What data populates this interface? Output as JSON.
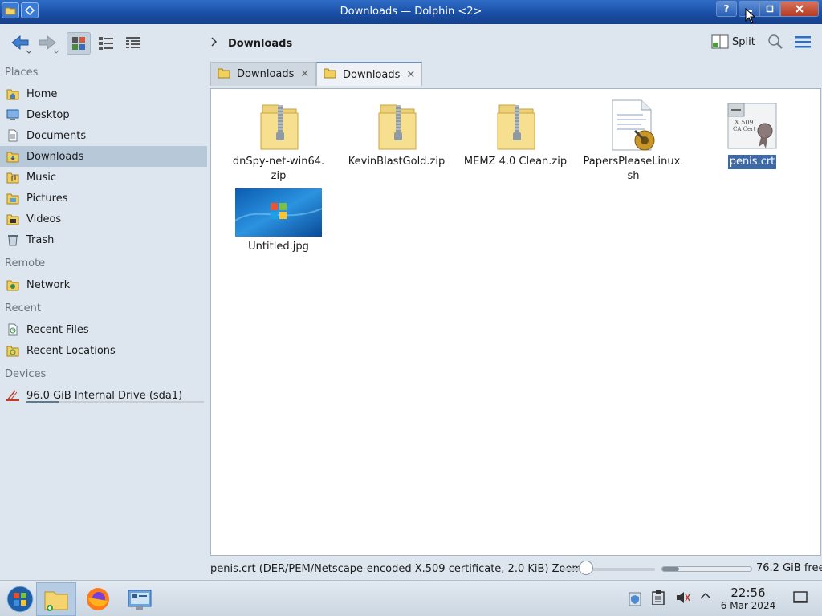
{
  "window": {
    "title": "Downloads — Dolphin <2>",
    "buttons": {
      "help": "?"
    }
  },
  "toolbar": {
    "breadcrumb": "Downloads",
    "split_label": "Split"
  },
  "sidebar": {
    "places_title": "Places",
    "places": [
      {
        "label": "Home",
        "icon": "home-folder-icon"
      },
      {
        "label": "Desktop",
        "icon": "desktop-icon"
      },
      {
        "label": "Documents",
        "icon": "documents-icon"
      },
      {
        "label": "Downloads",
        "icon": "downloads-folder-icon",
        "active": true
      },
      {
        "label": "Music",
        "icon": "music-folder-icon"
      },
      {
        "label": "Pictures",
        "icon": "pictures-folder-icon"
      },
      {
        "label": "Videos",
        "icon": "videos-folder-icon"
      },
      {
        "label": "Trash",
        "icon": "trash-icon"
      }
    ],
    "remote_title": "Remote",
    "remote": [
      {
        "label": "Network",
        "icon": "network-folder-icon"
      }
    ],
    "recent_title": "Recent",
    "recent": [
      {
        "label": "Recent Files",
        "icon": "recent-files-icon"
      },
      {
        "label": "Recent Locations",
        "icon": "recent-locations-icon"
      }
    ],
    "devices_title": "Devices",
    "devices": [
      {
        "label": "96.0 GiB Internal Drive (sda1)",
        "icon": "drive-icon",
        "used_fraction": 0.19
      }
    ]
  },
  "tabs": [
    {
      "label": "Downloads",
      "active": false
    },
    {
      "label": "Downloads",
      "active": true
    }
  ],
  "files": [
    {
      "name": "dnSpy-net-win64.\nzip",
      "type": "zip-folder"
    },
    {
      "name": "KevinBlastGold.zip",
      "type": "zip-folder"
    },
    {
      "name": "MEMZ 4.0 Clean.zip",
      "type": "zip-folder"
    },
    {
      "name": "PapersPleaseLinux.\nsh",
      "type": "script"
    },
    {
      "name": "penis.crt",
      "type": "certificate",
      "selected": true
    },
    {
      "name": "Untitled.jpg",
      "type": "image"
    }
  ],
  "status": {
    "text": "penis.crt (DER/PEM/Netscape-encoded X.509 certificate, 2.0 KiB) Zoom:",
    "zoom_fraction": 0.25,
    "free_space": "76.2 GiB free",
    "used_fraction": 0.19
  },
  "taskbar": {
    "time": "22:56",
    "date": "6 Mar 2024"
  },
  "colors": {
    "titlebar": "#1a4fa6",
    "selection": "#3d6aa6",
    "sidebar_active": "#b7c8d8"
  }
}
